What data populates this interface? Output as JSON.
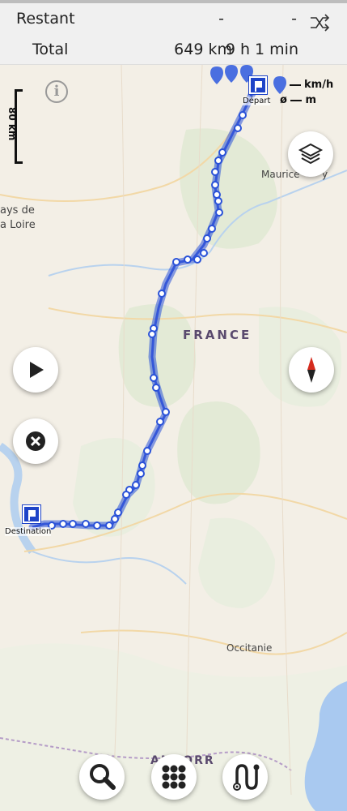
{
  "stats": {
    "remaining": {
      "label": "Restant",
      "distance": "-",
      "time": "-"
    },
    "total": {
      "label": "Total",
      "distance": "649 km",
      "time": "9 h 1 min"
    }
  },
  "map": {
    "scale_label": "80 km",
    "legend": {
      "speed_unit": "km/h",
      "elevation_prefix": "ø",
      "elevation_unit": "m"
    },
    "labels": {
      "country": "FRANCE",
      "region_occitanie": "Occitanie",
      "region_pays_de_la_loire_1": "ays de",
      "region_pays_de_la_loire_2": "a Loire",
      "town_maurice": "Maurice",
      "town_maurice_suffix": "y",
      "andorra": "ANDORR"
    },
    "start_label": "Départ",
    "destination_label": "Destination"
  },
  "icons": {
    "shuffle": "shuffle-cross-icon",
    "info": "info-icon",
    "layers": "layers-icon",
    "play": "play-icon",
    "close": "close-icon",
    "compass": "compass-icon",
    "search": "search-icon",
    "menu": "grid-menu-icon",
    "route": "route-icon"
  },
  "colors": {
    "route": "#2a52d8",
    "route_fill": "#5a7fee",
    "flag": "#1e44c8",
    "water": "#a9c9f0",
    "forest": "#dfe8cf",
    "pin": "#4a6fe0"
  }
}
